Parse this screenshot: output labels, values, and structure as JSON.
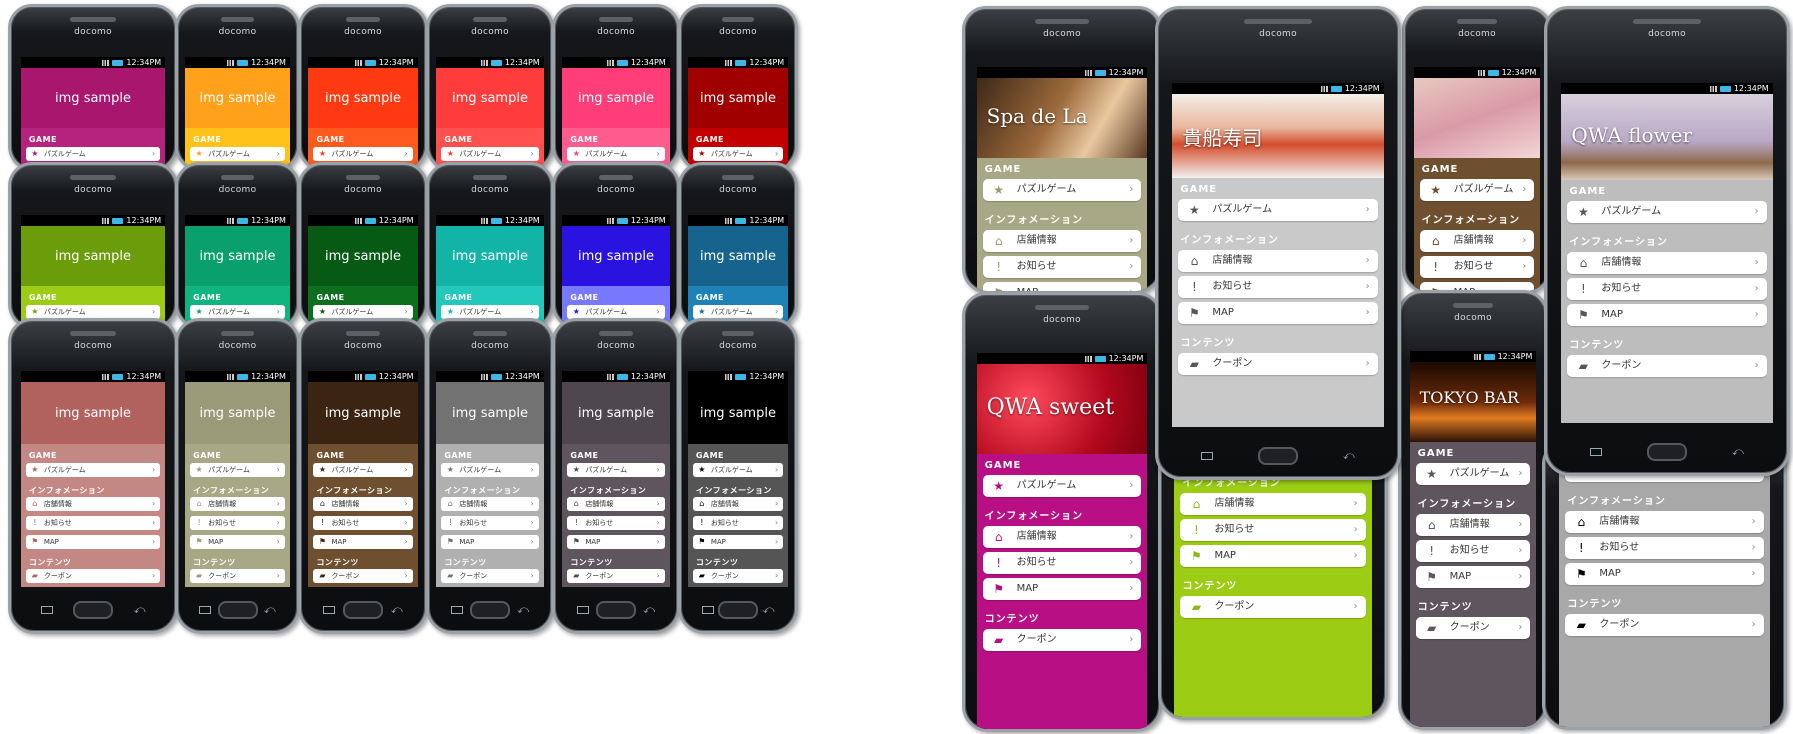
{
  "carrier": "docomo",
  "time": "12:34PM",
  "hero_text": "img sample",
  "labels": {
    "game": "GAME",
    "info": "インフォメーション",
    "contents": "コンテンツ",
    "puzzle": "パズルゲーム",
    "store": "店舗情報",
    "news": "お知らせ",
    "map": "MAP",
    "coupon": "クーポン"
  },
  "icons": {
    "star": "star-icon",
    "store": "store-icon",
    "news": "exclamation-icon",
    "map": "flag-icon",
    "coupon": "coupon-icon",
    "chevron": "chevron-right-icon"
  },
  "color_themes": [
    {
      "hero": "#a8166e",
      "band": "#b6237e"
    },
    {
      "hero": "#ffa11a",
      "band": "#ffc21a"
    },
    {
      "hero": "#ff3a12",
      "band": "#ff5a1e"
    },
    {
      "hero": "#ff3c3c",
      "band": "#ff5050"
    },
    {
      "hero": "#ff3d78",
      "band": "#ff5c8e"
    },
    {
      "hero": "#a00000",
      "band": "#c20000"
    },
    {
      "hero": "#6b9c0a",
      "band": "#9ccd14"
    },
    {
      "hero": "#0aa06e",
      "band": "#0fb47e"
    },
    {
      "hero": "#065a14",
      "band": "#0d6e1e"
    },
    {
      "hero": "#13b4a8",
      "band": "#22c8bb"
    },
    {
      "hero": "#2a12e0",
      "band": "#7878ff"
    },
    {
      "hero": "#16648e",
      "band": "#1e82b6"
    },
    {
      "hero": "#b2625e",
      "band": "#c48884"
    },
    {
      "hero": "#9a9a78",
      "band": "#a8a886"
    },
    {
      "hero": "#3b2412",
      "band": "#6e5030"
    },
    {
      "hero": "#727272",
      "band": "#b0b0b0"
    },
    {
      "hero": "#4e474e",
      "band": "#5f555f"
    },
    {
      "hero": "#000000",
      "band": "#555555"
    }
  ],
  "photo_phones": [
    {
      "title": "Spa de La",
      "band": "#a8a886",
      "accent": "#9a9a6a"
    },
    {
      "title": "貴船寿司",
      "band": "#c9c9c9",
      "accent": "#555555"
    },
    {
      "title": "",
      "band": "#6e5030",
      "accent": "#6e5030"
    },
    {
      "title": "QWA flower",
      "band": "#bdbdbd",
      "accent": "#555555"
    },
    {
      "title": "QWA sweet",
      "band": "#b80f84",
      "accent": "#b80f84"
    },
    {
      "title": "",
      "band": "#9ccd14",
      "accent": "#8ab814"
    },
    {
      "title": "TOKYO BAR",
      "band": "#5f555f",
      "accent": "#5f555f"
    },
    {
      "title": "",
      "band": "#a8a8a8",
      "accent": "#000000"
    }
  ]
}
